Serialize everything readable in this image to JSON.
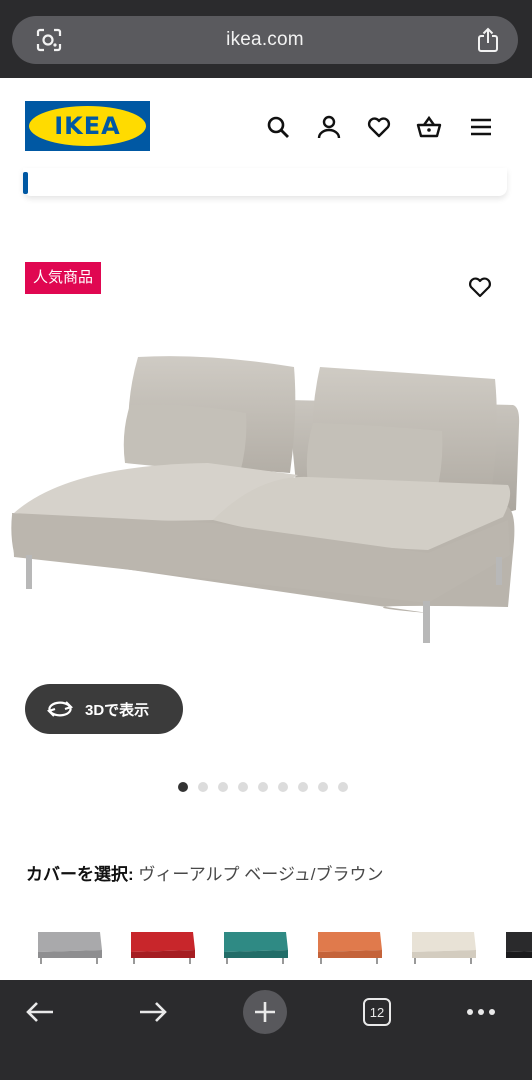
{
  "browser": {
    "url": "ikea.com",
    "tab_count": "12",
    "icons": [
      "lens-icon",
      "share-icon",
      "back-icon",
      "forward-icon",
      "new-tab-icon",
      "tabs-icon",
      "more-icon"
    ]
  },
  "header": {
    "logo_text": "IKEA",
    "icons": [
      "search-icon",
      "account-icon",
      "heart-icon",
      "cart-icon",
      "menu-icon"
    ]
  },
  "product": {
    "badge": "人気商品",
    "view_3d_label": "3Dで表示",
    "image_count": 9,
    "active_image": 1
  },
  "cover": {
    "label": "カバーを選択:",
    "value": "ヴィーアルプ ベージュ/ブラウン",
    "swatch_colors": [
      "#a9a9ab",
      "#c8262b",
      "#2f8a84",
      "#e07a4c",
      "#e8e2d6",
      "#2a2a2c"
    ]
  },
  "colors": {
    "ikea_blue": "#0058a3",
    "ikea_yellow": "#ffdb00",
    "badge_red": "#e00751"
  }
}
